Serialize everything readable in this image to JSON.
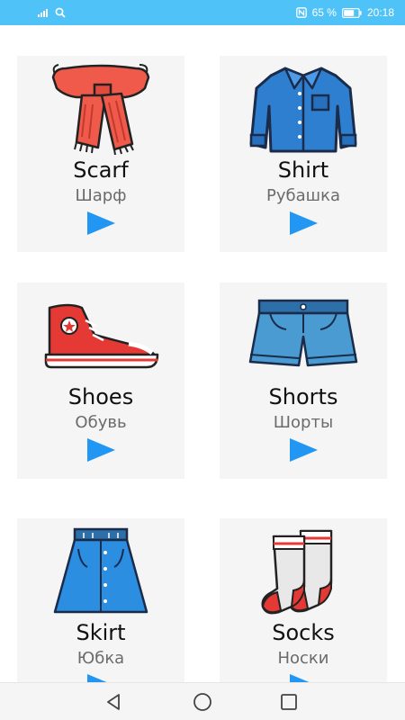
{
  "status_bar": {
    "battery_percent": "65 %",
    "time": "20:18",
    "icons": [
      "signal-icon",
      "search-icon",
      "nfc-icon",
      "battery-icon"
    ]
  },
  "colors": {
    "status_bar": "#4fc3f7",
    "play_button": "#2196f3",
    "card_background": "#f5f5f5"
  },
  "items": [
    {
      "english": "Scarf",
      "russian": "Шарф",
      "icon": "scarf-icon"
    },
    {
      "english": "Shirt",
      "russian": "Рубашка",
      "icon": "shirt-icon"
    },
    {
      "english": "Shoes",
      "russian": "Обувь",
      "icon": "shoe-icon"
    },
    {
      "english": "Shorts",
      "russian": "Шорты",
      "icon": "shorts-icon"
    },
    {
      "english": "Skirt",
      "russian": "Юбка",
      "icon": "skirt-icon"
    },
    {
      "english": "Socks",
      "russian": "Носки",
      "icon": "socks-icon"
    }
  ],
  "nav_bar": {
    "icons": [
      "back-icon",
      "home-icon",
      "recents-icon"
    ]
  }
}
